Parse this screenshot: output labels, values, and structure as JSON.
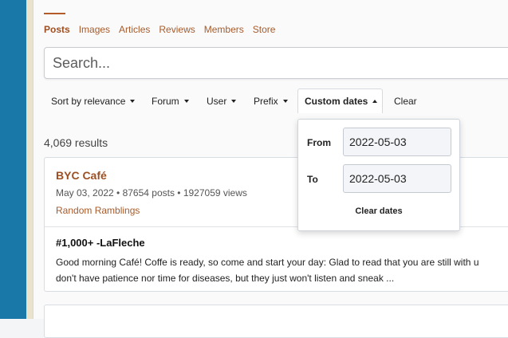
{
  "tabs": [
    {
      "label": "Posts",
      "active": true
    },
    {
      "label": "Images"
    },
    {
      "label": "Articles"
    },
    {
      "label": "Reviews"
    },
    {
      "label": "Members"
    },
    {
      "label": "Store"
    }
  ],
  "search": {
    "placeholder": "Search..."
  },
  "filters": {
    "sort": "Sort by relevance",
    "forum": "Forum",
    "user": "User",
    "prefix": "Prefix",
    "custom_dates": "Custom dates",
    "clear": "Clear"
  },
  "results_count": "4,069 results",
  "result": {
    "title": "BYC Café",
    "meta": "May 03, 2022 • 87654 posts • 1927059 views",
    "forum": "Random Ramblings",
    "post_title": "#1,000+ -LaFleche",
    "snippet_line1": "Good morning Café! Coffe is ready, so come and start your day: Glad to read that you are still with u",
    "snippet_line2": "don't have patience nor time for diseases, but they just won't listen and sneak ..."
  },
  "date_popup": {
    "from_label": "From",
    "from_value": "2022-05-03",
    "to_label": "To",
    "to_value": "2022-05-03",
    "clear_dates": "Clear dates"
  },
  "colors": {
    "accent": "#a65b2c",
    "sidebar": "#1a78a8"
  }
}
